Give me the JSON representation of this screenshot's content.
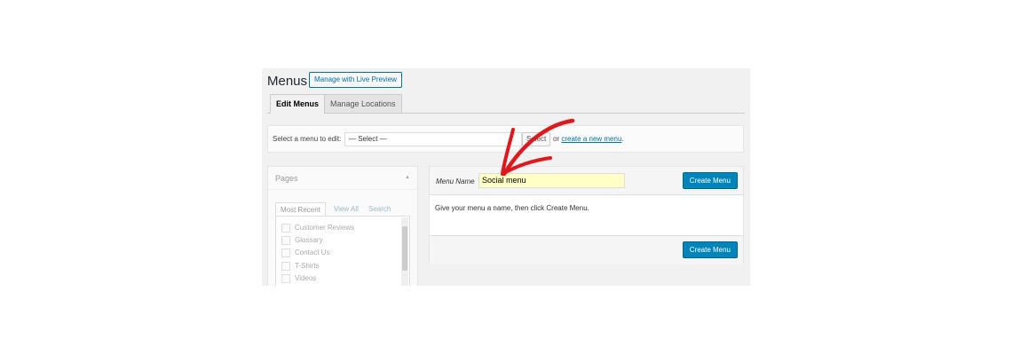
{
  "header": {
    "title": "Menus",
    "live_preview_label": "Manage with Live Preview"
  },
  "tabs": [
    {
      "label": "Edit Menus",
      "active": true
    },
    {
      "label": "Manage Locations",
      "active": false
    }
  ],
  "select_menu": {
    "label": "Select a menu to edit:",
    "selected": "— Select —",
    "select_button": "Select",
    "or_text": "or",
    "create_link": "create a new menu",
    "period": "."
  },
  "pages_panel": {
    "title": "Pages",
    "tabs": [
      "Most Recent",
      "View All",
      "Search"
    ],
    "items": [
      "Customer Reviews",
      "Glossary",
      "Contact Us",
      "T-Shirts",
      "Videos"
    ]
  },
  "menu_edit": {
    "name_label": "Menu Name",
    "name_value": "Social menu",
    "create_button": "Create Menu",
    "instructions": "Give your menu a name, then click Create Menu.",
    "create_button_bottom": "Create Menu"
  },
  "colors": {
    "primary_button": "#0085ba",
    "link": "#0073aa",
    "input_highlight": "#ffffc6",
    "annotation_arrow": "#e0181b"
  }
}
